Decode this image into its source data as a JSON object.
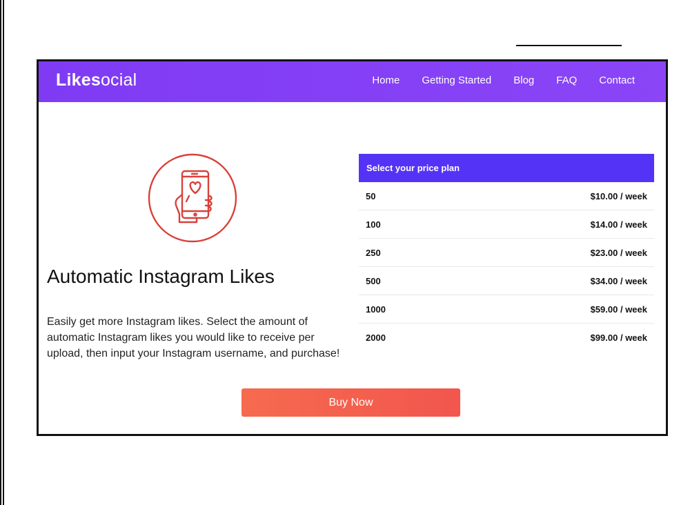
{
  "brand": {
    "logo_bold": "Likes",
    "logo_light": "ocial"
  },
  "nav": {
    "items": [
      "Home",
      "Getting Started",
      "Blog",
      "FAQ",
      "Contact"
    ]
  },
  "hero": {
    "icon": "phone-heart-hand-icon",
    "title": "Automatic Instagram Likes",
    "description": "Easily get more Instagram likes. Select the amount of automatic Instagram likes you would like to receive per upload, then input your Instagram username, and purchase!"
  },
  "pricing": {
    "header": "Select your price plan",
    "rows": [
      {
        "amount": "50",
        "price": "$10.00 / week"
      },
      {
        "amount": "100",
        "price": "$14.00 / week"
      },
      {
        "amount": "250",
        "price": "$23.00 / week"
      },
      {
        "amount": "500",
        "price": "$34.00 / week"
      },
      {
        "amount": "1000",
        "price": "$59.00 / week"
      },
      {
        "amount": "2000",
        "price": "$99.00 / week"
      }
    ]
  },
  "cta": {
    "label": "Buy Now"
  },
  "colors": {
    "nav": "#8040f5",
    "plan_header": "#5533f6",
    "button": "#f4604e",
    "icon": "#d8413a"
  }
}
